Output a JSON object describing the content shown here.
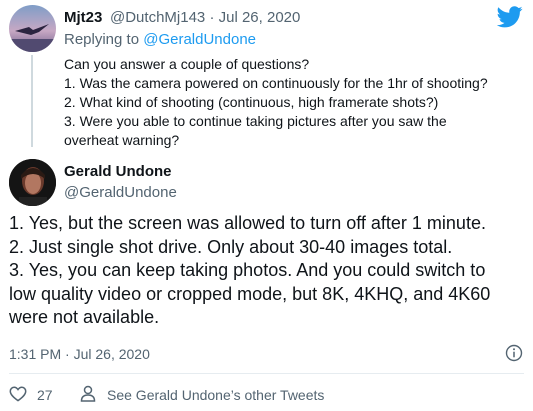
{
  "reply_tweet": {
    "display_name": "Mjt23",
    "handle": "@DutchMj143",
    "separator": "·",
    "date": "Jul 26, 2020",
    "replying_prefix": "Replying to",
    "replying_to": "@GeraldUndone",
    "lines": [
      "Can you answer a couple of questions?",
      "1. Was the camera powered on continuously for the 1hr of shooting?",
      "2. What kind of shooting (continuous, high framerate shots?)",
      "3. Were you able to continue taking pictures after you saw the",
      "overheat warning?"
    ]
  },
  "main_tweet": {
    "display_name": "Gerald Undone",
    "handle": "@GeraldUndone",
    "lines": [
      "1. Yes, but the screen was allowed to turn off after 1 minute.",
      "2. Just single shot drive. Only about 30-40 images total.",
      "3. Yes, you can keep taking photos. And you could switch to",
      "low quality video or cropped mode, but 8K, 4KHQ, and 4K60",
      "were not available."
    ],
    "timestamp": "1:31 PM · Jul 26, 2020"
  },
  "footer": {
    "likes": "27",
    "see_other_tweets": "See Gerald Undone’s other Tweets"
  },
  "colors": {
    "twitter_blue": "#1d9bf0",
    "secondary_text": "#536471"
  }
}
